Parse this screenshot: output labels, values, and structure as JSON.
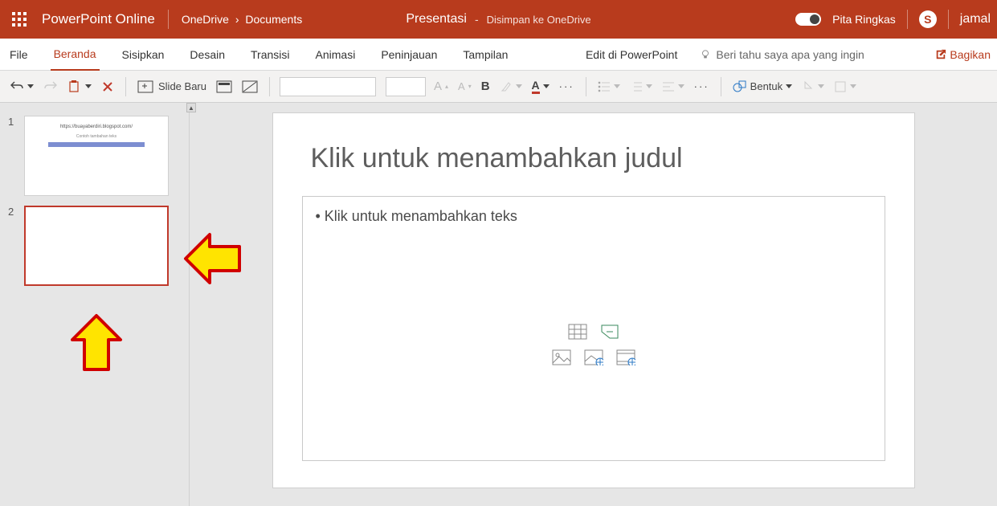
{
  "titlebar": {
    "app_name": "PowerPoint Online",
    "breadcrumb": {
      "root": "OneDrive",
      "sep": "›",
      "folder": "Documents"
    },
    "doc_name": "Presentasi",
    "dash": "-",
    "save_status": "Disimpan ke OneDrive",
    "pita": "Pita Ringkas",
    "user": "jamal"
  },
  "tabs": {
    "file": "File",
    "beranda": "Beranda",
    "sisipkan": "Sisipkan",
    "desain": "Desain",
    "transisi": "Transisi",
    "animasi": "Animasi",
    "peninjauan": "Peninjauan",
    "tampilan": "Tampilan",
    "edit_pp": "Edit di PowerPoint",
    "tellme": "Beri tahu saya apa yang ingin",
    "share": "Bagikan"
  },
  "toolbar": {
    "new_slide": "Slide Baru",
    "bold": "B",
    "bentuk": "Bentuk",
    "ellipsis": "···"
  },
  "thumbs": {
    "slide1": {
      "num": "1",
      "title": "https://buayaberdiri.blogspot.com/",
      "body": "Contoh tambahan teks"
    },
    "slide2": {
      "num": "2"
    }
  },
  "slide": {
    "title_placeholder": "Klik untuk menambahkan judul",
    "body_placeholder": "• Klik untuk menambahkan teks"
  },
  "colors": {
    "brand": "#b83b1d"
  }
}
